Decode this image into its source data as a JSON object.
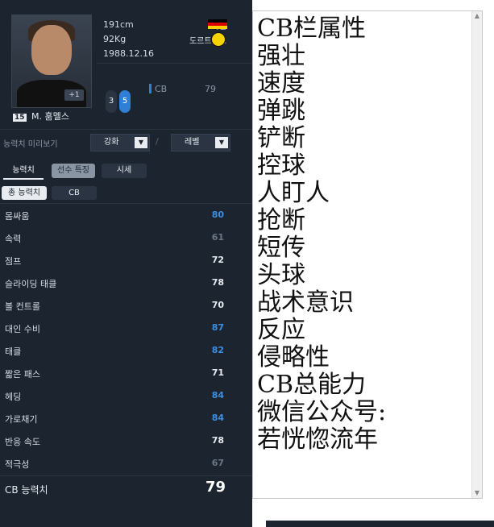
{
  "player": {
    "height": "191cm",
    "weight": "92Kg",
    "birthdate": "1988.12.16",
    "nation": "독일",
    "team": "도르트문트",
    "number": "15",
    "name": "M. 훔멜스",
    "plus_badge": "+1",
    "pill_a": "3",
    "pill_b": "5",
    "position": "CB",
    "position_value": "79"
  },
  "controls": {
    "preview_label": "능력치 미리보기",
    "enhance_label": "강화",
    "level_label": "레벨",
    "slash": "/"
  },
  "tabs": [
    {
      "label": "능력치"
    },
    {
      "label": "선수 특징"
    },
    {
      "label": "시세"
    }
  ],
  "subtabs": [
    {
      "label": "총 능력치"
    },
    {
      "label": "CB"
    }
  ],
  "stats": [
    {
      "label": "몸싸움",
      "value": "80",
      "color": "#3d8fe0"
    },
    {
      "label": "속력",
      "value": "61",
      "color": "#6b7684"
    },
    {
      "label": "점프",
      "value": "72",
      "color": "#e8ecf0"
    },
    {
      "label": "슬라이딩 태클",
      "value": "78",
      "color": "#e8ecf0"
    },
    {
      "label": "볼 컨트롤",
      "value": "70",
      "color": "#e8ecf0"
    },
    {
      "label": "대인 수비",
      "value": "87",
      "color": "#3d8fe0"
    },
    {
      "label": "태클",
      "value": "82",
      "color": "#3d8fe0"
    },
    {
      "label": "짧은 패스",
      "value": "71",
      "color": "#e8ecf0"
    },
    {
      "label": "헤딩",
      "value": "84",
      "color": "#3d8fe0"
    },
    {
      "label": "가로채기",
      "value": "84",
      "color": "#3d8fe0"
    },
    {
      "label": "반응 속도",
      "value": "78",
      "color": "#e8ecf0"
    },
    {
      "label": "적극성",
      "value": "67",
      "color": "#6b7684"
    }
  ],
  "total": {
    "label": "CB 능력치",
    "value": "79"
  },
  "right_panel": {
    "lines": [
      "CB栏属性",
      "强壮",
      "速度",
      "弹跳",
      "铲断",
      "控球",
      "人盯人",
      "抢断",
      "短传",
      "头球",
      "战术意识",
      "反应",
      "侵略性",
      "CB总能力",
      "微信公众号:",
      "若恍惚流年"
    ]
  },
  "colors": {
    "panel_bg": "#1c2430",
    "accent_blue": "#3d8fe0",
    "muted": "#6b7684"
  }
}
